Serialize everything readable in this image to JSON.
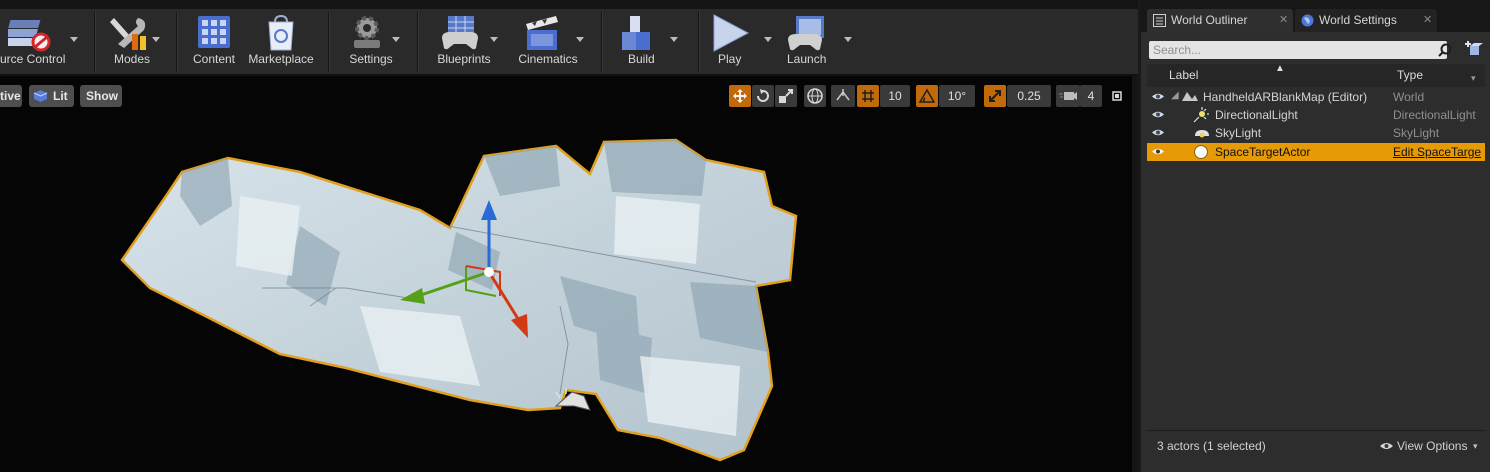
{
  "toolbar": {
    "buttons": [
      {
        "label": "urce Control",
        "icon": "source-control-icon"
      },
      {
        "label": "Modes",
        "icon": "modes-icon"
      },
      {
        "label": "Content",
        "icon": "content-icon"
      },
      {
        "label": "Marketplace",
        "icon": "marketplace-icon"
      },
      {
        "label": "Settings",
        "icon": "settings-icon"
      },
      {
        "label": "Blueprints",
        "icon": "blueprints-icon"
      },
      {
        "label": "Cinematics",
        "icon": "cinematics-icon"
      },
      {
        "label": "Build",
        "icon": "build-icon"
      },
      {
        "label": "Play",
        "icon": "play-icon"
      },
      {
        "label": "Launch",
        "icon": "launch-icon"
      }
    ]
  },
  "viewport": {
    "perspective_label": "tive",
    "lit_label": "Lit",
    "show_label": "Show",
    "grid_snap": "10",
    "rotation_snap": "10°",
    "scale_snap": "0.25",
    "camera_speed": "4"
  },
  "outliner": {
    "tabs": [
      {
        "label": "World Outliner"
      },
      {
        "label": "World Settings"
      }
    ],
    "search_placeholder": "Search...",
    "columns": {
      "label": "Label",
      "type": "Type"
    },
    "rows": [
      {
        "label": "HandheldARBlankMap (Editor)",
        "type": "World",
        "icon": "world-map-icon"
      },
      {
        "label": "DirectionalLight",
        "type": "DirectionalLight",
        "icon": "directional-light-icon"
      },
      {
        "label": "SkyLight",
        "type": "SkyLight",
        "icon": "sky-light-icon"
      },
      {
        "label": "SpaceTargetActor",
        "type": "Edit SpaceTarge",
        "icon": "actor-sphere-icon",
        "selected": true
      }
    ],
    "status": "3 actors (1 selected)",
    "view_options": "View Options"
  },
  "colors": {
    "selection": "#e69a05",
    "mesh": "#c8d5dc",
    "outline": "#e2a020",
    "gizmo_x": "#d23a14",
    "gizmo_y": "#55a018",
    "gizmo_z": "#2a6ad8"
  }
}
